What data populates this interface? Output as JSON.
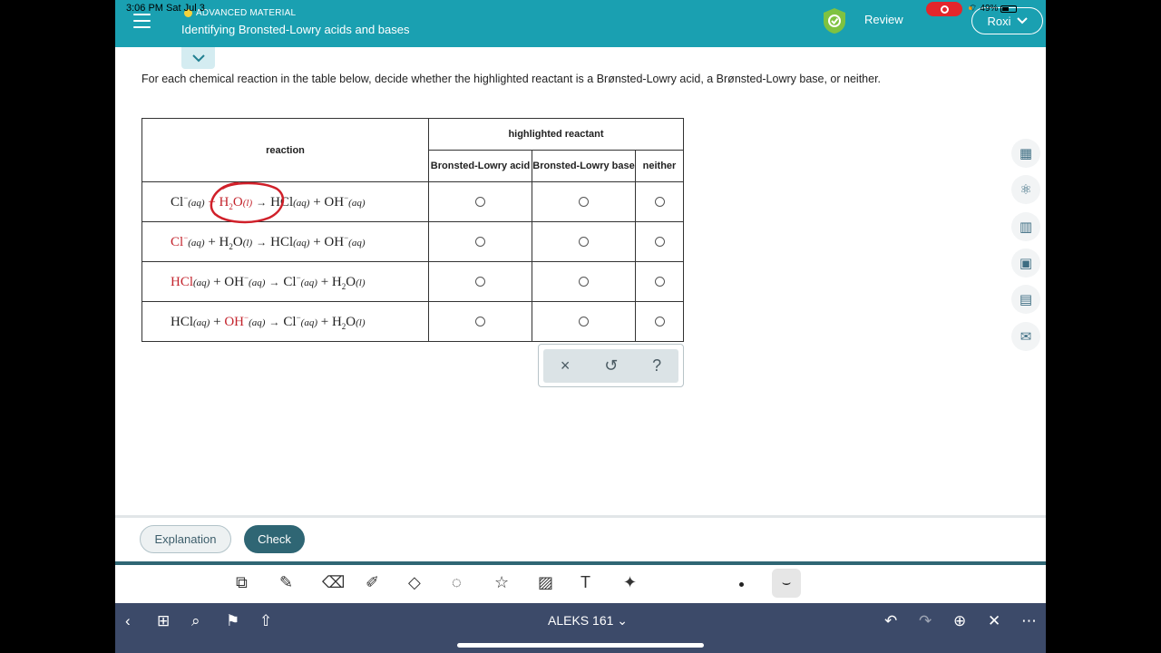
{
  "status": {
    "time": "3:06 PM  Sat Jul 3",
    "battery": "49%"
  },
  "header": {
    "section_label": "ADVANCED MATERIAL",
    "topic_title": "Identifying Bronsted-Lowry acids and bases",
    "review_label": "Review",
    "user_name": "Roxi"
  },
  "question": {
    "instructions": "For each chemical reaction in the table below, decide whether the highlighted reactant is a Brønsted-Lowry acid, a Brønsted-Lowry base, or neither.",
    "col_reaction": "reaction",
    "col_group": "highlighted reactant",
    "col_acid": "Bronsted-Lowry acid",
    "col_base": "Bronsted-Lowry base",
    "col_neither": "neither"
  },
  "answer_tools": {
    "clear": "×",
    "undo": "↺",
    "help": "?"
  },
  "footer": {
    "explanation_label": "Explanation",
    "check_label": "Check"
  },
  "bottom_nav": {
    "title": "ALEKS 161 ⌄"
  },
  "colors": {
    "header": "#1aa0b1",
    "highlight": "#c3242d",
    "check": "#2f6674",
    "nav": "#3c4a69"
  },
  "icons": [
    "calculator-icon",
    "periodic-table-icon",
    "data-chart-icon",
    "reference-icon",
    "textbook-icon",
    "mail-icon"
  ]
}
